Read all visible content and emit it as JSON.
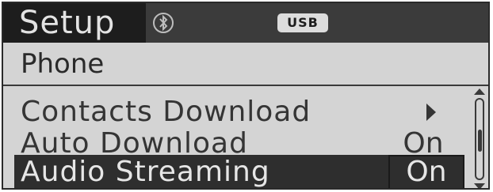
{
  "status_bar": {
    "mode_label": "Setup",
    "bluetooth_icon": "bluetooth-icon",
    "usb_label": "USB"
  },
  "menu": {
    "title": "Phone",
    "items": [
      {
        "label": "Contacts Download",
        "value": "",
        "icon": "chevron-right-icon",
        "selected": false
      },
      {
        "label": "Auto Download",
        "value": "On",
        "selected": false
      },
      {
        "label": "Audio Streaming",
        "value": "On",
        "selected": true
      }
    ]
  },
  "scrollbar": {
    "position_fraction": 0.45
  },
  "colors": {
    "screen_background": "#d4d4d4",
    "bar_background": "#3b3b3b",
    "highlight": "#2e2e2e",
    "text_dark": "#353535",
    "text_light": "#e6e6e6"
  }
}
